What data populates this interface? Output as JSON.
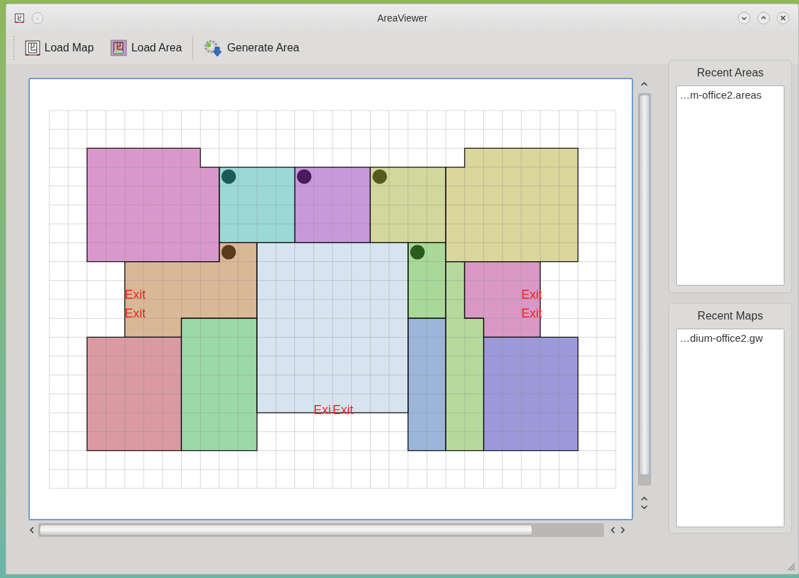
{
  "window": {
    "title": "AreaViewer"
  },
  "toolbar": [
    {
      "label": "Load Map",
      "kind": "map"
    },
    {
      "label": "Load Area",
      "kind": "area"
    },
    {
      "label": "Generate Area",
      "kind": "generate"
    }
  ],
  "map": {
    "rooms": [
      {
        "color": "#d998cb"
      },
      {
        "color": "#9cd9d6"
      },
      {
        "color": "#c899d9"
      },
      {
        "color": "#d2d89d"
      },
      {
        "color": "#dad69c"
      },
      {
        "color": "#d9b898"
      },
      {
        "color": "#d7e4f0"
      },
      {
        "color": "#a9d999"
      },
      {
        "color": "#b6d99b"
      },
      {
        "color": "#d999c4"
      },
      {
        "color": "#d99aa2"
      },
      {
        "color": "#9cd9a8"
      },
      {
        "color": "#9bb6d9"
      },
      {
        "color": "#9c99d9"
      }
    ],
    "markers": [
      {
        "color": "#1b5b56"
      },
      {
        "color": "#4a1c5b"
      },
      {
        "color": "#545b1c"
      },
      {
        "color": "#5b3a1c"
      },
      {
        "color": "#2b5b1c"
      }
    ],
    "exits": [
      {
        "label": "Exit"
      },
      {
        "label": "Exit"
      },
      {
        "label": "Exit"
      },
      {
        "label": "Exit"
      },
      {
        "label": "Exi"
      },
      {
        "label": "Exit"
      }
    ]
  },
  "recent_areas": {
    "title": "Recent Areas",
    "items": [
      "…m-office2.areas"
    ]
  },
  "recent_maps": {
    "title": "Recent Maps",
    "items": [
      "…dium-office2.gw"
    ]
  }
}
